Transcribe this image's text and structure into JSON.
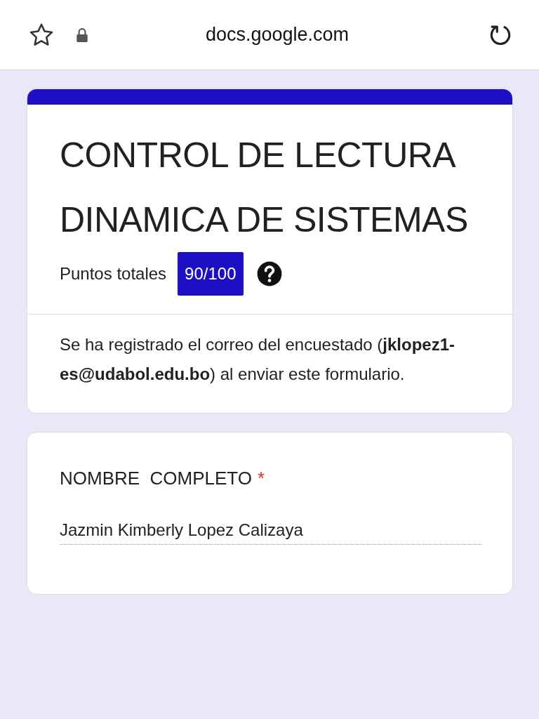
{
  "browser": {
    "address": "docs.google.com"
  },
  "form": {
    "title": "CONTROL DE LECTURA DINAMICA DE SISTEMAS",
    "score_label": "Puntos totales",
    "score": "90/100",
    "notice": "Se ha registrado el correo del encuestado (**jklopez1-es@udabol.edu.bo**) al enviar este formulario."
  },
  "questions": [
    {
      "label": "NOMBRE  COMPLETO",
      "required": true,
      "required_mark": "*",
      "answer": "Jazmin Kimberly Lopez Calizaya"
    }
  ]
}
